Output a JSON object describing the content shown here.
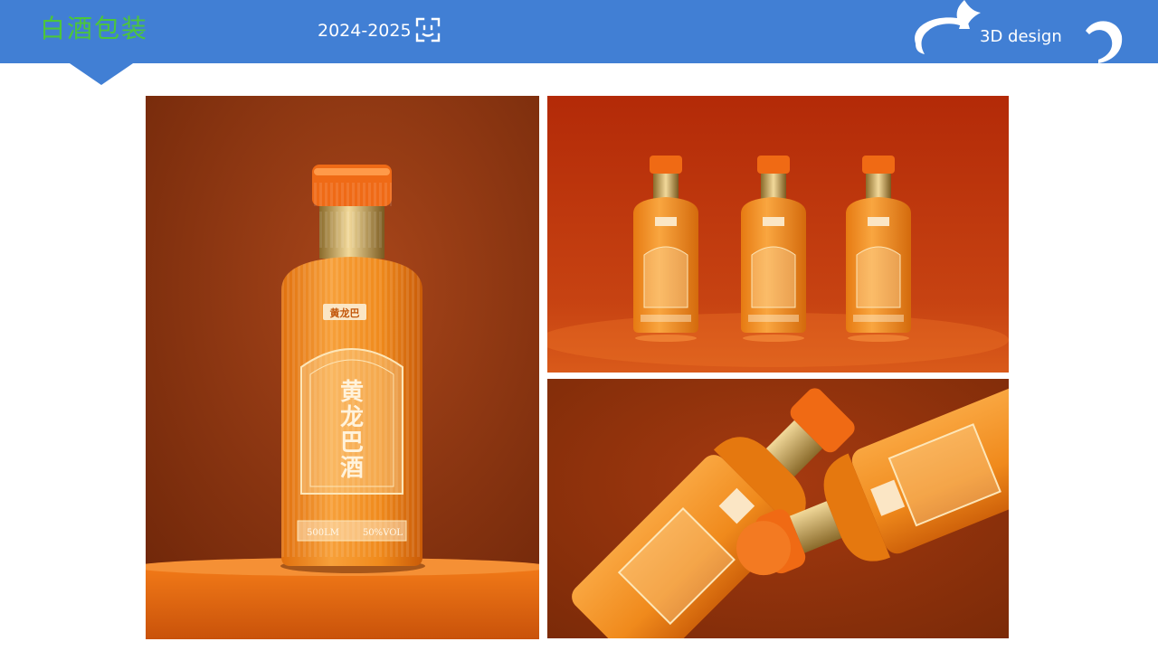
{
  "header": {
    "title": "白酒包装",
    "years": "2024-2025",
    "design_label": "3D design",
    "icons": [
      "face-scan-icon",
      "sparkle-cloud-decoration"
    ]
  },
  "bottle": {
    "brand_small": "黄龙巴",
    "brand_large": "黄龙巴酒",
    "volume": "500LM",
    "abv": "50%VOL"
  },
  "colors": {
    "header_blue": "#417fd4",
    "title_green": "#4cc63a",
    "bottle_orange": "#f08a1c",
    "backdrop_rust": "#8a3511"
  }
}
